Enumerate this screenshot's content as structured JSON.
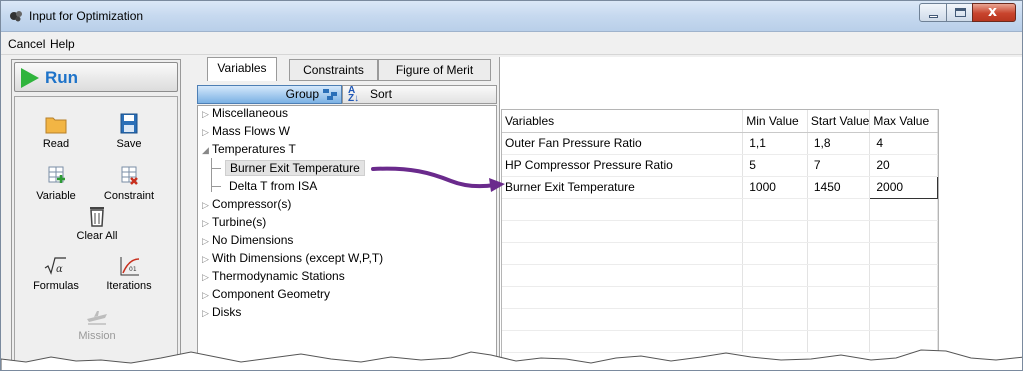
{
  "window": {
    "title": "Input for Optimization",
    "close_glyph": "x"
  },
  "menu": [
    "Cancel",
    "Help"
  ],
  "run": {
    "label": "Run",
    "color": "#1e73c9",
    "icon_color": "#2fb43c"
  },
  "tools": [
    {
      "label": "Read",
      "icon": "folder-icon",
      "enabled": true
    },
    {
      "label": "Save",
      "icon": "floppy-disk-icon",
      "enabled": true
    },
    {
      "label": "Variable",
      "icon": "add-variable-icon",
      "enabled": true
    },
    {
      "label": "Constraint",
      "icon": "add-constraint-icon",
      "enabled": true
    },
    {
      "label": "Clear All",
      "icon": "trash-icon",
      "enabled": true
    },
    {
      "label": "Formulas",
      "icon": "sqrt-alpha-icon",
      "enabled": true
    },
    {
      "label": "Iterations",
      "icon": "iterations-icon",
      "enabled": true
    },
    {
      "label": "Mission",
      "icon": "airplane-icon",
      "enabled": false
    }
  ],
  "tabs": [
    {
      "label": "Variables",
      "active": true
    },
    {
      "label": "Constraints",
      "active": false
    },
    {
      "label": "Figure of Merit",
      "active": false
    }
  ],
  "toolbar": {
    "group_label": "Group",
    "sort_label": "Sort"
  },
  "tree": [
    {
      "label": "Miscellaneous",
      "level": 0,
      "expanded": false
    },
    {
      "label": "Mass Flows W",
      "level": 0,
      "expanded": false
    },
    {
      "label": "Temperatures T",
      "level": 0,
      "expanded": true
    },
    {
      "label": "Burner Exit Temperature",
      "level": 1,
      "selected": true
    },
    {
      "label": "Delta T from ISA",
      "level": 1
    },
    {
      "label": "Compressor(s)",
      "level": 0,
      "expanded": false
    },
    {
      "label": "Turbine(s)",
      "level": 0,
      "expanded": false
    },
    {
      "label": "No Dimensions",
      "level": 0,
      "expanded": false
    },
    {
      "label": "With Dimensions (except W,P,T)",
      "level": 0,
      "expanded": false
    },
    {
      "label": "Thermodynamic Stations",
      "level": 0,
      "expanded": false
    },
    {
      "label": "Component Geometry",
      "level": 0,
      "expanded": false
    },
    {
      "label": "Disks",
      "level": 0,
      "expanded": false
    }
  ],
  "grid": {
    "columns": [
      "Variables",
      "Min Value",
      "Start Value",
      "Max Value"
    ],
    "rows": [
      [
        "Outer Fan Pressure Ratio",
        "1,1",
        "1,8",
        "4"
      ],
      [
        "HP Compressor Pressure Ratio",
        "5",
        "7",
        "20"
      ],
      [
        "Burner Exit Temperature",
        "1000",
        "1450",
        "2000"
      ]
    ]
  },
  "annotation_arrow_color": "#6a2a8c"
}
